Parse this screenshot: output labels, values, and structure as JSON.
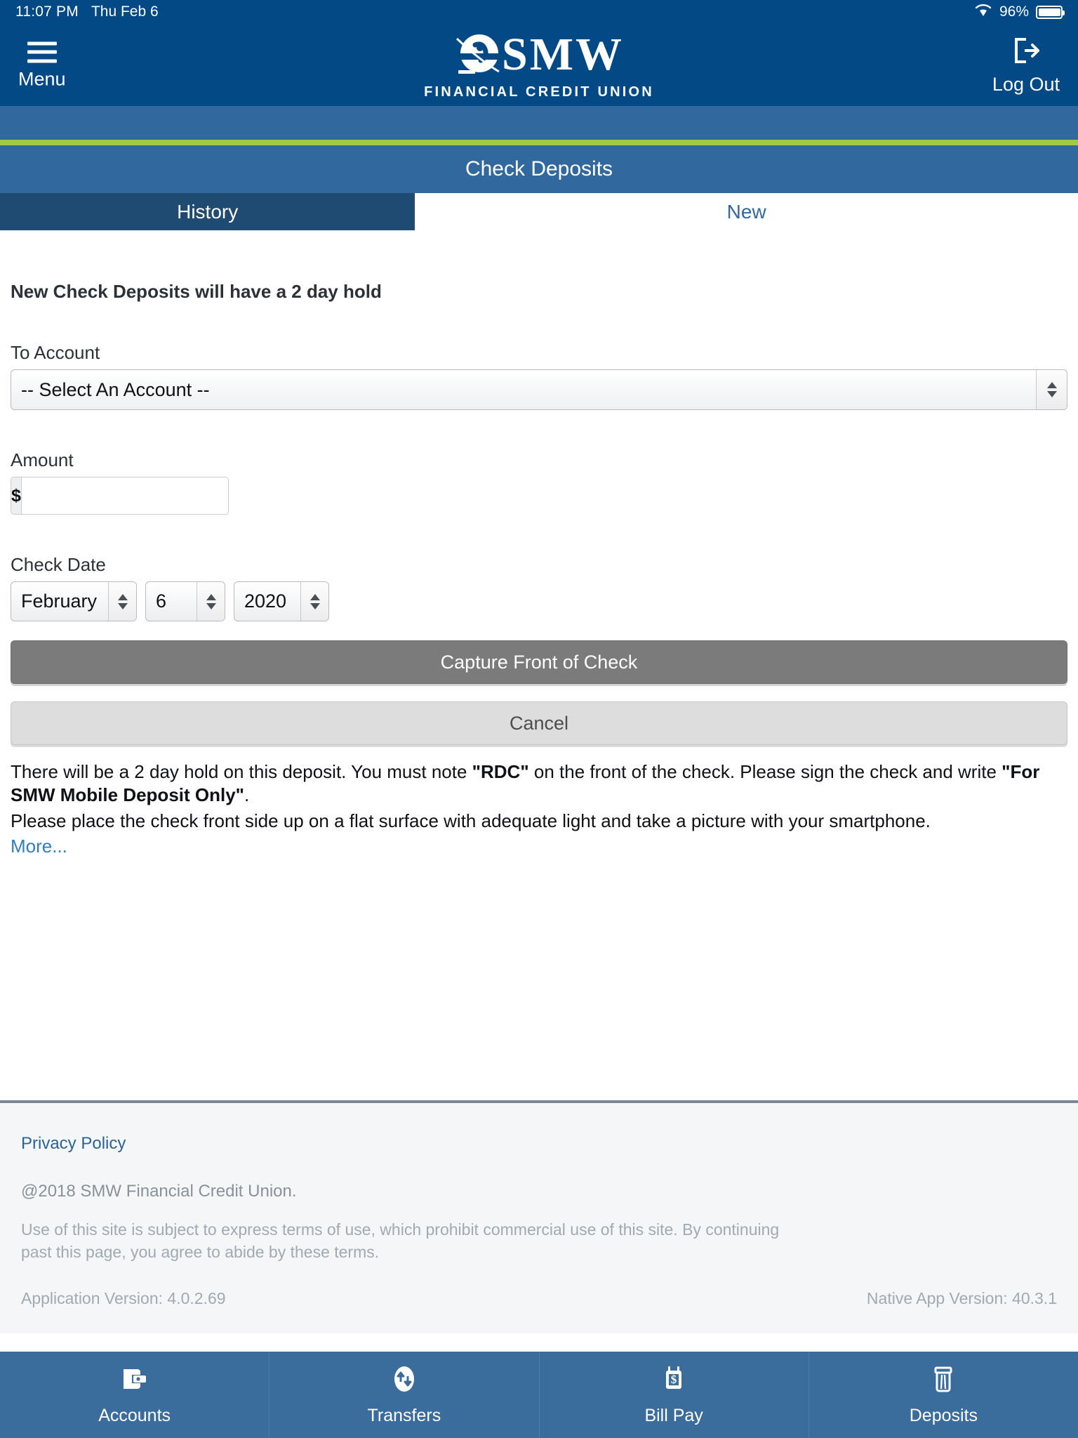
{
  "status_bar": {
    "time": "11:07 PM",
    "date": "Thu Feb 6",
    "battery_percent": "96%",
    "wifi_icon": "wifi-icon",
    "battery_icon": "battery-icon"
  },
  "header": {
    "menu_label": "Menu",
    "menu_icon": "hamburger-icon",
    "logout_label": "Log Out",
    "logout_icon": "logout-icon",
    "logo_text": "SMW",
    "logo_subtext": "FINANCIAL CREDIT UNION",
    "brand_color": "#024985",
    "accent_color": "#a5c84b"
  },
  "page": {
    "title": "Check Deposits"
  },
  "tabs": [
    {
      "label": "History",
      "active": true
    },
    {
      "label": "New",
      "active": false
    }
  ],
  "form": {
    "notice": "New Check Deposits will have a 2 day hold",
    "to_account": {
      "label": "To Account",
      "selected": "-- Select An Account --"
    },
    "amount": {
      "label": "Amount",
      "currency_symbol": "$",
      "value": "",
      "placeholder": ""
    },
    "check_date": {
      "label": "Check Date",
      "month": "February",
      "day": "6",
      "year": "2020"
    },
    "capture_button": "Capture Front of Check",
    "cancel_button": "Cancel"
  },
  "instructions": {
    "line1_part1": "There will be a 2 day hold on this deposit. You must note ",
    "line1_bold1": "\"RDC\"",
    "line1_part2": " on the front of the check. Please sign the check and write ",
    "line1_bold2": "\"For SMW Mobile Deposit Only\"",
    "line1_part3": ".",
    "line2": "Please place the check front side up on a flat surface with adequate light and take a picture with your smartphone.",
    "more_link": "More..."
  },
  "footer": {
    "privacy_policy": "Privacy Policy",
    "copyright": "@2018 SMW Financial Credit Union.",
    "terms": "Use of this site is subject to express terms of use, which prohibit commercial use of this site. By continuing past this page, you agree to abide by these terms.",
    "application_version": "Application Version: 4.0.2.69",
    "native_app_version": "Native App Version: 40.3.1"
  },
  "bottom_nav": [
    {
      "label": "Accounts",
      "icon": "wallet-icon"
    },
    {
      "label": "Transfers",
      "icon": "transfer-arrows-icon"
    },
    {
      "label": "Bill Pay",
      "icon": "bill-dollar-icon"
    },
    {
      "label": "Deposits",
      "icon": "check-deposit-icon"
    }
  ]
}
